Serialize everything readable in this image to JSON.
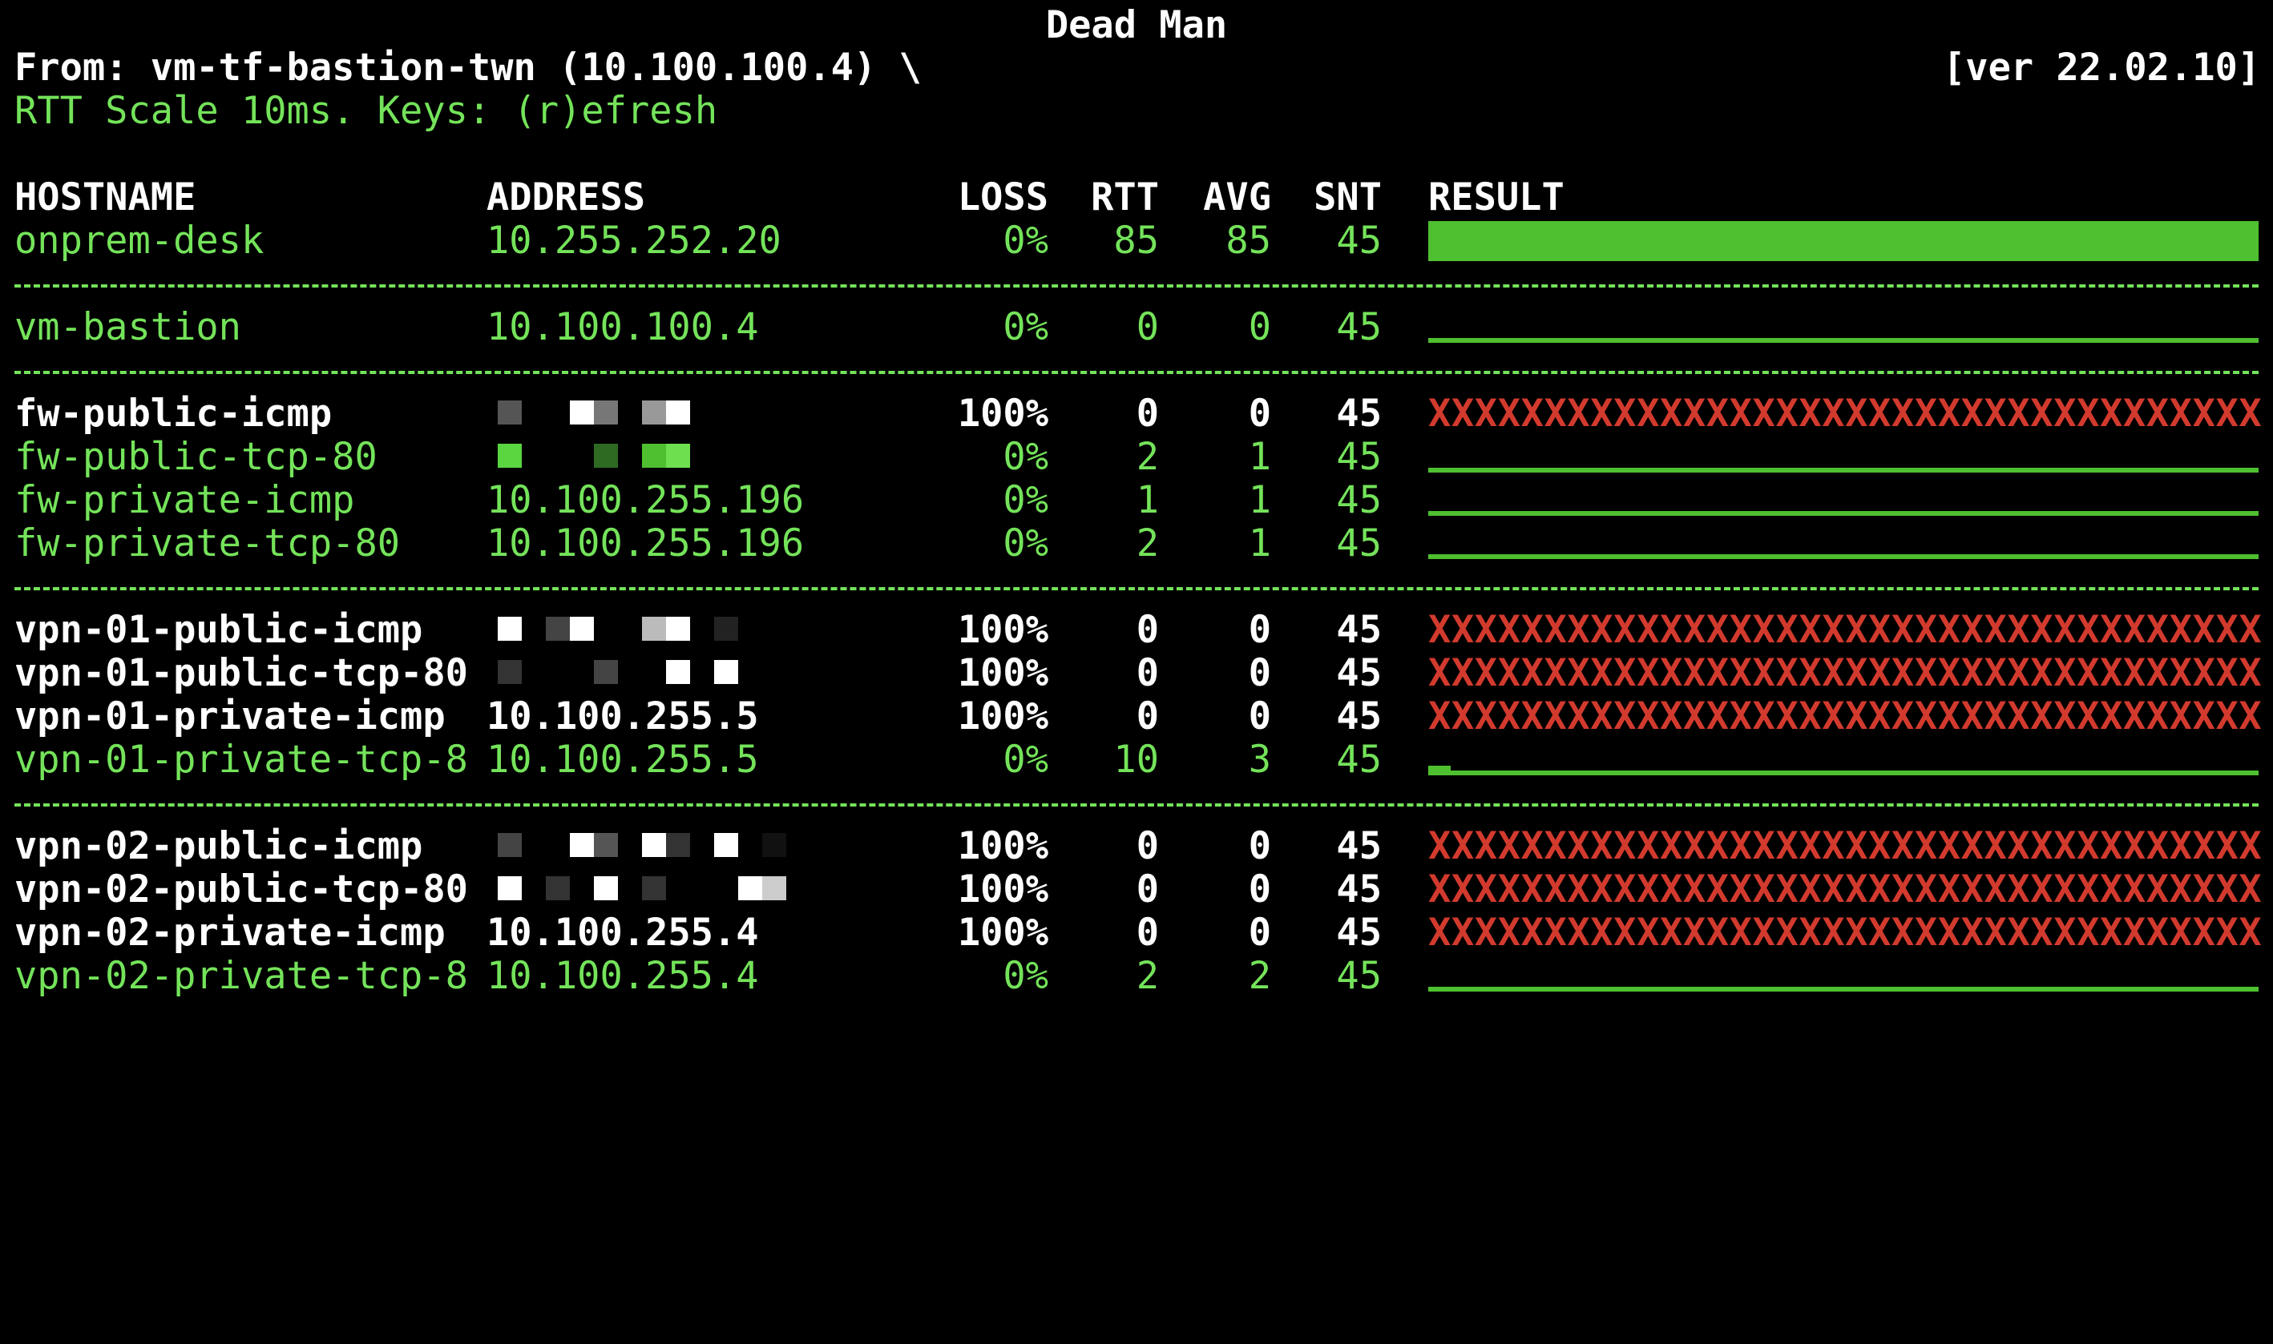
{
  "title": "Dead Man",
  "from_line": "From: vm-tf-bastion-twn (10.100.100.4) \\",
  "version": "[ver 22.02.10]",
  "scale_line": "RTT Scale 10ms. Keys: (r)efresh",
  "headers": {
    "hostname": "HOSTNAME",
    "address": "ADDRESS",
    "loss": "LOSS",
    "rtt": "RTT",
    "avg": "AVG",
    "snt": "SNT",
    "result": "RESULT"
  },
  "rows": [
    {
      "hostname": "onprem-desk",
      "address": "10.255.252.20",
      "loss": "0%",
      "rtt": "85",
      "avg": "85",
      "snt": "45"
    },
    {
      "hostname": "vm-bastion",
      "address": "10.100.100.4",
      "loss": "0%",
      "rtt": "0",
      "avg": "0",
      "snt": "45"
    },
    {
      "hostname": "fw-public-icmp",
      "address": "",
      "loss": "100%",
      "rtt": "0",
      "avg": "0",
      "snt": "45"
    },
    {
      "hostname": "fw-public-tcp-80",
      "address": "",
      "loss": "0%",
      "rtt": "2",
      "avg": "1",
      "snt": "45"
    },
    {
      "hostname": "fw-private-icmp",
      "address": "10.100.255.196",
      "loss": "0%",
      "rtt": "1",
      "avg": "1",
      "snt": "45"
    },
    {
      "hostname": "fw-private-tcp-80",
      "address": "10.100.255.196",
      "loss": "0%",
      "rtt": "2",
      "avg": "1",
      "snt": "45"
    },
    {
      "hostname": "vpn-01-public-icmp",
      "address": "",
      "loss": "100%",
      "rtt": "0",
      "avg": "0",
      "snt": "45"
    },
    {
      "hostname": "vpn-01-public-tcp-80",
      "address": "",
      "loss": "100%",
      "rtt": "0",
      "avg": "0",
      "snt": "45"
    },
    {
      "hostname": "vpn-01-private-icmp",
      "address": "10.100.255.5",
      "loss": "100%",
      "rtt": "0",
      "avg": "0",
      "snt": "45"
    },
    {
      "hostname": "vpn-01-private-tcp-8",
      "address": "10.100.255.5",
      "loss": "0%",
      "rtt": "10",
      "avg": "3",
      "snt": "45"
    },
    {
      "hostname": "vpn-02-public-icmp",
      "address": "",
      "loss": "100%",
      "rtt": "0",
      "avg": "0",
      "snt": "45"
    },
    {
      "hostname": "vpn-02-public-tcp-80",
      "address": "",
      "loss": "100%",
      "rtt": "0",
      "avg": "0",
      "snt": "45"
    },
    {
      "hostname": "vpn-02-private-icmp",
      "address": "10.100.255.4",
      "loss": "100%",
      "rtt": "0",
      "avg": "0",
      "snt": "45"
    },
    {
      "hostname": "vpn-02-private-tcp-8",
      "address": "10.100.255.4",
      "loss": "0%",
      "rtt": "2",
      "avg": "2",
      "snt": "45"
    }
  ],
  "fail_marker": "XXXXXXXXXXXXXXXXXXXXXXXXXXXXXXXXXXXXX",
  "colors": {
    "ok": "#74e35a",
    "fail": "#ffffff",
    "bar": "#4ec02f",
    "x": "#d23a2e",
    "background": "#000000"
  }
}
